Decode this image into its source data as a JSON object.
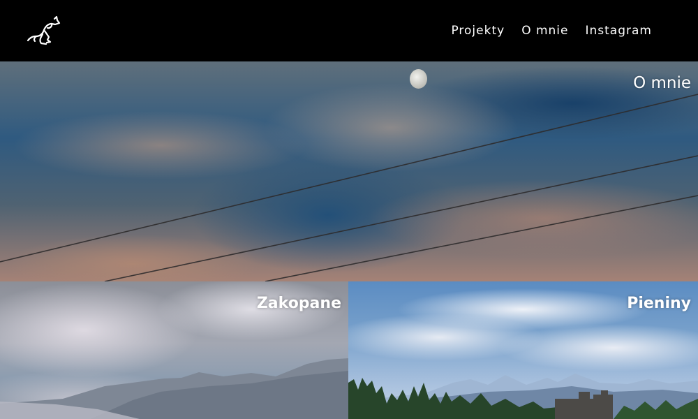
{
  "header": {
    "logo_icon": "kangaroo-icon",
    "nav": [
      {
        "label": "Projekty"
      },
      {
        "label": "O mnie"
      },
      {
        "label": "Instagram"
      }
    ]
  },
  "hero": {
    "title": "O mnie",
    "image": "sky-clouds-moon-wires"
  },
  "gallery": [
    {
      "title": "Zakopane",
      "image": "mountains-clouds"
    },
    {
      "title": "Pieniny",
      "image": "mountains-castle-forest"
    }
  ],
  "colors": {
    "nav_background": "#000000",
    "text": "#ffffff"
  }
}
